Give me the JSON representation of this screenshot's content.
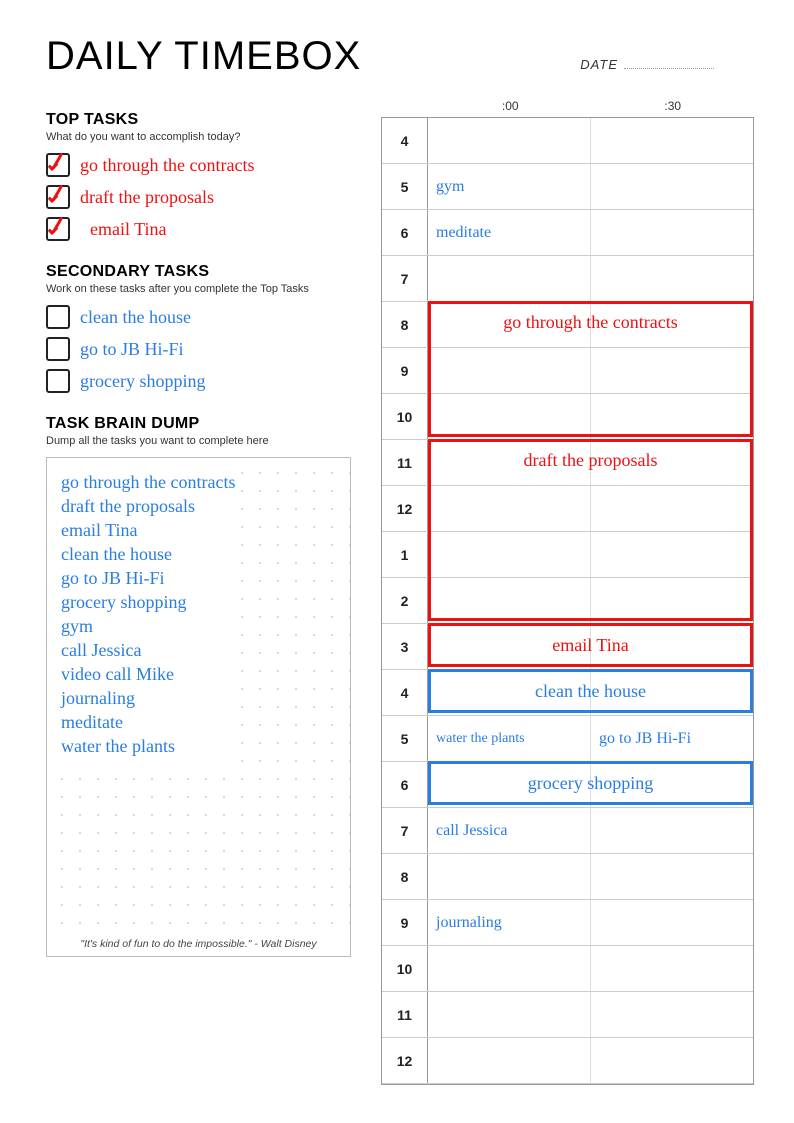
{
  "title": "DAILY TIMEBOX",
  "date_label": "DATE",
  "sections": {
    "top": {
      "heading": "TOP TASKS",
      "sub": "What do you want to accomplish today?"
    },
    "secondary": {
      "heading": "SECONDARY TASKS",
      "sub": "Work on these tasks after you complete the Top Tasks"
    },
    "braindump": {
      "heading": "TASK BRAIN DUMP",
      "sub": "Dump all the tasks you want to complete here"
    }
  },
  "top_tasks": [
    {
      "label": "go through the contracts",
      "checked": true
    },
    {
      "label": "draft the proposals",
      "checked": true
    },
    {
      "label": "email Tina",
      "checked": true
    }
  ],
  "secondary_tasks": [
    {
      "label": "clean the house",
      "checked": false
    },
    {
      "label": "go to JB Hi-Fi",
      "checked": false
    },
    {
      "label": "grocery shopping",
      "checked": false
    }
  ],
  "braindump": [
    "go through the contracts",
    "draft the proposals",
    "email Tina",
    "clean the house",
    "go to JB Hi-Fi",
    "grocery shopping",
    "gym",
    "call Jessica",
    "video call Mike",
    "journaling",
    "meditate",
    "water the plants"
  ],
  "quote": "\"It's kind of fun to do the impossible.\" - Walt Disney",
  "schedule": {
    "head00": ":00",
    "head30": ":30",
    "hours": [
      "4",
      "5",
      "6",
      "7",
      "8",
      "9",
      "10",
      "11",
      "12",
      "1",
      "2",
      "3",
      "4",
      "5",
      "6",
      "7",
      "8",
      "9",
      "10",
      "11",
      "12"
    ],
    "cells": {
      "1_0": "gym",
      "2_0": "meditate",
      "13_0": "water the plants",
      "13_1": "go to JB Hi-Fi",
      "15_0": "call Jessica",
      "17_0": "journaling"
    },
    "blocks": [
      {
        "label": "go through the contracts",
        "start": 4,
        "span": 3,
        "color": "red",
        "align": "top"
      },
      {
        "label": "draft the proposals",
        "start": 7,
        "span": 4,
        "color": "red",
        "align": "top"
      },
      {
        "label": "email Tina",
        "start": 11,
        "span": 1,
        "color": "red",
        "align": "center"
      },
      {
        "label": "clean the house",
        "start": 12,
        "span": 1,
        "color": "blue",
        "align": "center"
      },
      {
        "label": "grocery shopping",
        "start": 14,
        "span": 1,
        "color": "blue",
        "align": "center"
      }
    ]
  }
}
